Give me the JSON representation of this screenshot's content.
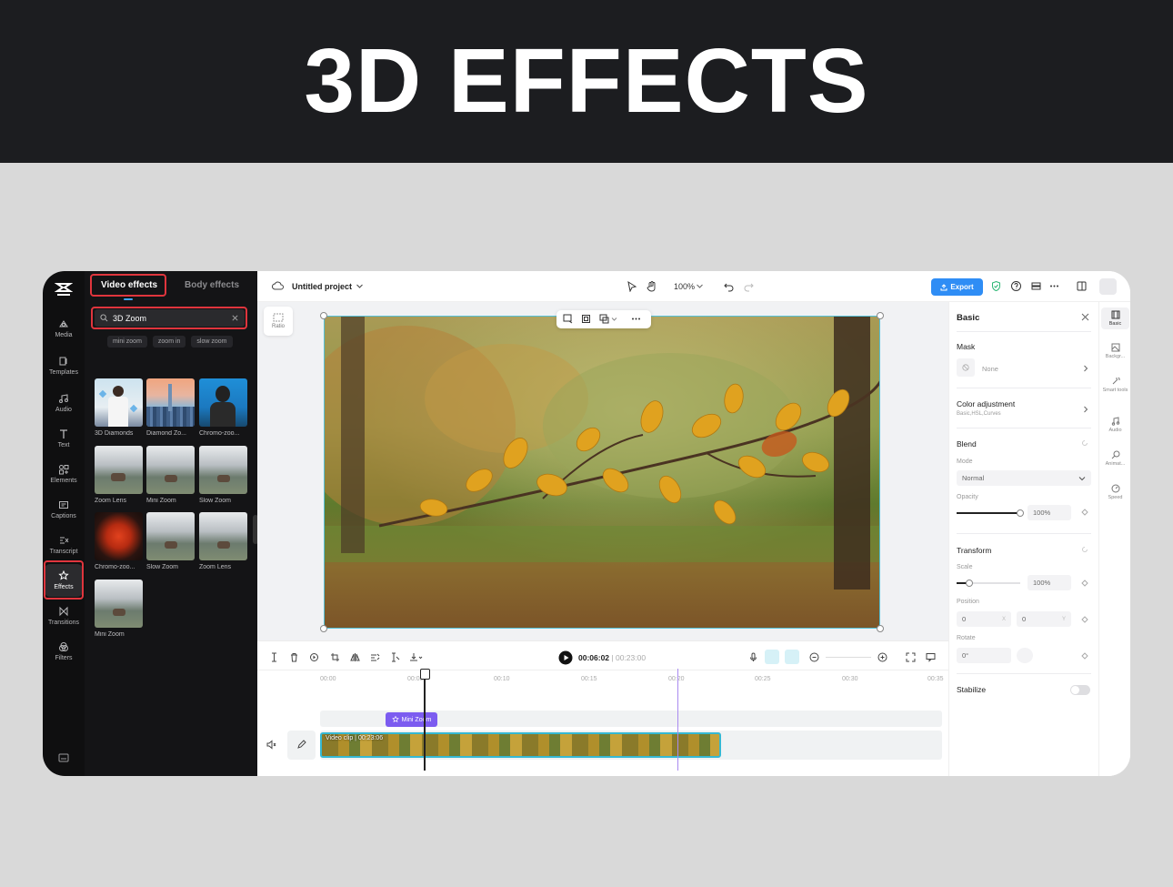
{
  "banner": {
    "title": "3D EFFECTS"
  },
  "rail": {
    "items": [
      {
        "label": "Media",
        "icon": "media-icon"
      },
      {
        "label": "Templates",
        "icon": "templates-icon"
      },
      {
        "label": "Audio",
        "icon": "audio-icon"
      },
      {
        "label": "Text",
        "icon": "text-icon"
      },
      {
        "label": "Elements",
        "icon": "elements-icon"
      },
      {
        "label": "Captions",
        "icon": "captions-icon"
      },
      {
        "label": "Transcript",
        "icon": "transcript-icon"
      },
      {
        "label": "Effects",
        "icon": "effects-icon",
        "active": true
      },
      {
        "label": "Transitions",
        "icon": "transitions-icon"
      },
      {
        "label": "Filters",
        "icon": "filters-icon"
      }
    ]
  },
  "effects_panel": {
    "tabs": [
      "Video effects",
      "Body effects"
    ],
    "search": {
      "value": "3D Zoom"
    },
    "suggestions": [
      "mini zoom",
      "zoom in",
      "slow zoom"
    ],
    "results": [
      {
        "label": "3D Diamonds"
      },
      {
        "label": "Diamond Zo..."
      },
      {
        "label": "Chromo-zoo..."
      },
      {
        "label": "Zoom Lens"
      },
      {
        "label": "Mini Zoom"
      },
      {
        "label": "Slow Zoom"
      },
      {
        "label": "Chromo-zoo..."
      },
      {
        "label": "Slow Zoom"
      },
      {
        "label": "Zoom Lens"
      },
      {
        "label": "Mini Zoom"
      }
    ]
  },
  "topbar": {
    "project_title": "Untitled project",
    "zoom": "100%",
    "export_label": "Export"
  },
  "canvas": {
    "ratio_label": "Ratio"
  },
  "inspector": {
    "title": "Basic",
    "mask": {
      "label": "Mask",
      "value": "None"
    },
    "color_adjustment": {
      "label": "Color adjustment",
      "sub": "Basic,HSL,Curves"
    },
    "blend": {
      "label": "Blend",
      "mode_label": "Mode",
      "mode_value": "Normal",
      "opacity_label": "Opacity",
      "opacity_value": "100%",
      "opacity_level": 1.0
    },
    "transform": {
      "label": "Transform",
      "scale_label": "Scale",
      "scale_value": "100%",
      "scale_level": 0.2,
      "position_label": "Position",
      "pos_x": "0",
      "pos_x_unit": "X",
      "pos_y": "0",
      "pos_y_unit": "Y",
      "rotate_label": "Rotate",
      "rotate_value": "0°"
    },
    "stabilize_label": "Stabilize"
  },
  "side_tools": [
    {
      "label": "Basic",
      "icon": "basic-icon"
    },
    {
      "label": "Backgr...",
      "icon": "background-icon"
    },
    {
      "label": "Smart tools",
      "icon": "smart-tools-icon"
    },
    {
      "label": "Audio",
      "icon": "audio-icon"
    },
    {
      "label": "Animat...",
      "icon": "animation-icon"
    },
    {
      "label": "Speed",
      "icon": "speed-icon"
    }
  ],
  "timeline": {
    "current_time": "00:06:02",
    "total_time": "00:23:00",
    "ruler": [
      "00:00",
      "00:05",
      "00:10",
      "00:15",
      "00:20",
      "00:25",
      "00:30",
      "00:35"
    ],
    "clip_label": "Video clip",
    "clip_duration": "00:23:06",
    "effect_label": "Mini Zoom"
  },
  "colors": {
    "accent": "#2f8df5",
    "highlight": "#e0353d",
    "selection": "#35b8d2",
    "effect": "#7c5cf0"
  }
}
